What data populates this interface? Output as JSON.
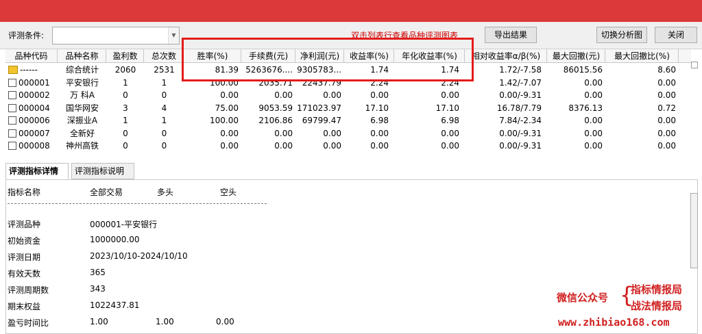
{
  "toolbar": {
    "condition_label": "评测条件:",
    "condition_value": "",
    "hint": "双击列表行查看品种评测图表",
    "export_label": "导出结果",
    "switch_label": "切换分析图",
    "close_label": "关闭"
  },
  "table": {
    "headers": [
      "品种代码",
      "品种名称",
      "盈利数",
      "总次数",
      "胜率(%)",
      "手续费(元)",
      "净利润(元)",
      "收益率(%)",
      "年化收益率(%)",
      "相对收益率α/β(%)",
      "最大回撤(元)",
      "最大回撤比(%)"
    ],
    "rows": [
      [
        "------",
        "综合统计",
        "2060",
        "2531",
        "81.39",
        "5263676....",
        "9305783...",
        "1.74",
        "1.74",
        "1.72/-7.58",
        "86015.56",
        "8.60"
      ],
      [
        "000001",
        "平安银行",
        "1",
        "1",
        "100.00",
        "2035.71",
        "22437.79",
        "2.24",
        "2.24",
        "1.42/-7.07",
        "0.00",
        "0.00"
      ],
      [
        "000002",
        "万 科A",
        "0",
        "0",
        "0.00",
        "0.00",
        "0.00",
        "0.00",
        "0.00",
        "0.00/-9.31",
        "0.00",
        "0.00"
      ],
      [
        "000004",
        "国华网安",
        "3",
        "4",
        "75.00",
        "9053.59",
        "171023.97",
        "17.10",
        "17.10",
        "16.78/7.79",
        "8376.13",
        "0.72"
      ],
      [
        "000006",
        "深振业A",
        "1",
        "1",
        "100.00",
        "2106.86",
        "69799.47",
        "6.98",
        "6.98",
        "7.84/-2.34",
        "0.00",
        "0.00"
      ],
      [
        "000007",
        "全新好",
        "0",
        "0",
        "0.00",
        "0.00",
        "0.00",
        "0.00",
        "0.00",
        "0.00/-9.31",
        "0.00",
        "0.00"
      ],
      [
        "000008",
        "神州高铁",
        "0",
        "0",
        "0.00",
        "0.00",
        "0.00",
        "0.00",
        "0.00",
        "0.00/-9.31",
        "0.00",
        "0.00"
      ]
    ]
  },
  "tabs": [
    "评测指标详情",
    "评测指标说明"
  ],
  "detail": {
    "header": [
      "指标名称",
      "全部交易",
      "多头",
      "空头"
    ],
    "rows": [
      {
        "label": "评测品种",
        "values": [
          "000001-平安银行"
        ]
      },
      {
        "label": "初始资金",
        "values": [
          "1000000.00"
        ]
      },
      {
        "label": "评测日期",
        "values": [
          "2023/10/10-2024/10/10"
        ]
      },
      {
        "label": "有效天数",
        "values": [
          "365"
        ]
      },
      {
        "label": "评测周期数",
        "values": [
          "343"
        ]
      },
      {
        "label": "期末权益",
        "values": [
          "1022437.81"
        ]
      },
      {
        "label": "盈亏时间比",
        "values": [
          "1.00",
          "1.00",
          "0.00"
        ]
      }
    ]
  },
  "watermark": {
    "label": "微信公众号",
    "brace": "{",
    "line1": "指标情报局",
    "line2": "战法情报局",
    "url": "www.zhibiao168.com"
  },
  "icons": {
    "dropdown": "chevron-down-icon",
    "summary_row": "folder-icon",
    "row_check": "checkbox-icon"
  },
  "colors": {
    "titlebar": "#dc3a3a",
    "hint": "#cc0000",
    "highlight_box": "#e31b1b"
  }
}
